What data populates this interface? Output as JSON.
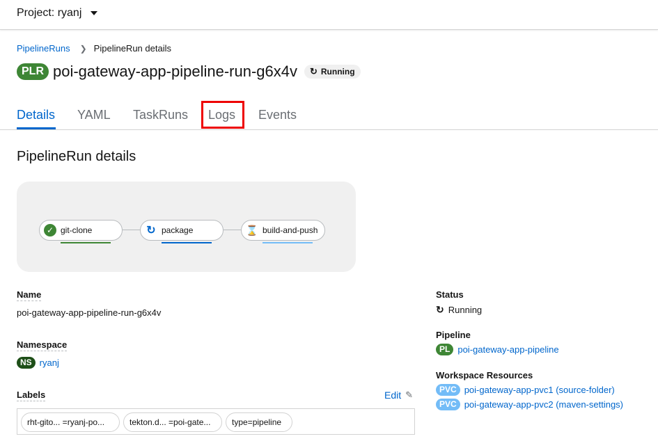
{
  "topbar": {
    "project_label": "Project: ryanj"
  },
  "breadcrumb": {
    "parent": "PipelineRuns",
    "current": "PipelineRun details"
  },
  "header": {
    "badge": "PLR",
    "title": "poi-gateway-app-pipeline-run-g6x4v",
    "status": "Running"
  },
  "tabs": [
    {
      "label": "Details",
      "active": true
    },
    {
      "label": "YAML"
    },
    {
      "label": "TaskRuns"
    },
    {
      "label": "Logs"
    },
    {
      "label": "Events"
    }
  ],
  "section_title": "PipelineRun details",
  "pipeline_graph": {
    "tasks": [
      {
        "name": "git-clone",
        "state": "succeeded",
        "icon": "check-circle-icon",
        "color": "#3e8635"
      },
      {
        "name": "package",
        "state": "running",
        "icon": "sync-icon",
        "color": "#0066cc"
      },
      {
        "name": "build-and-push",
        "state": "pending",
        "icon": "hourglass-icon",
        "color": "#73bcf7"
      }
    ]
  },
  "details": {
    "name_label": "Name",
    "name_value": "poi-gateway-app-pipeline-run-g6x4v",
    "namespace_label": "Namespace",
    "namespace_badge": "NS",
    "namespace_value": "ryanj",
    "labels_label": "Labels",
    "edit_label": "Edit",
    "labels": [
      "rht-gito...  =ryanj-po...",
      "tekton.d...  =poi-gate...",
      "type=pipeline"
    ]
  },
  "side": {
    "status_label": "Status",
    "status_value": "Running",
    "pipeline_label": "Pipeline",
    "pipeline_badge": "PL",
    "pipeline_value": "poi-gateway-app-pipeline",
    "workspace_label": "Workspace Resources",
    "workspaces": [
      {
        "badge": "PVC",
        "value": "poi-gateway-app-pvc1 (source-folder)"
      },
      {
        "badge": "PVC",
        "value": "poi-gateway-app-pvc2 (maven-settings)"
      }
    ]
  },
  "colors": {
    "accent": "#0066cc",
    "success": "#3e8635",
    "pvc": "#73bcf7",
    "highlight": "#ee0000"
  }
}
